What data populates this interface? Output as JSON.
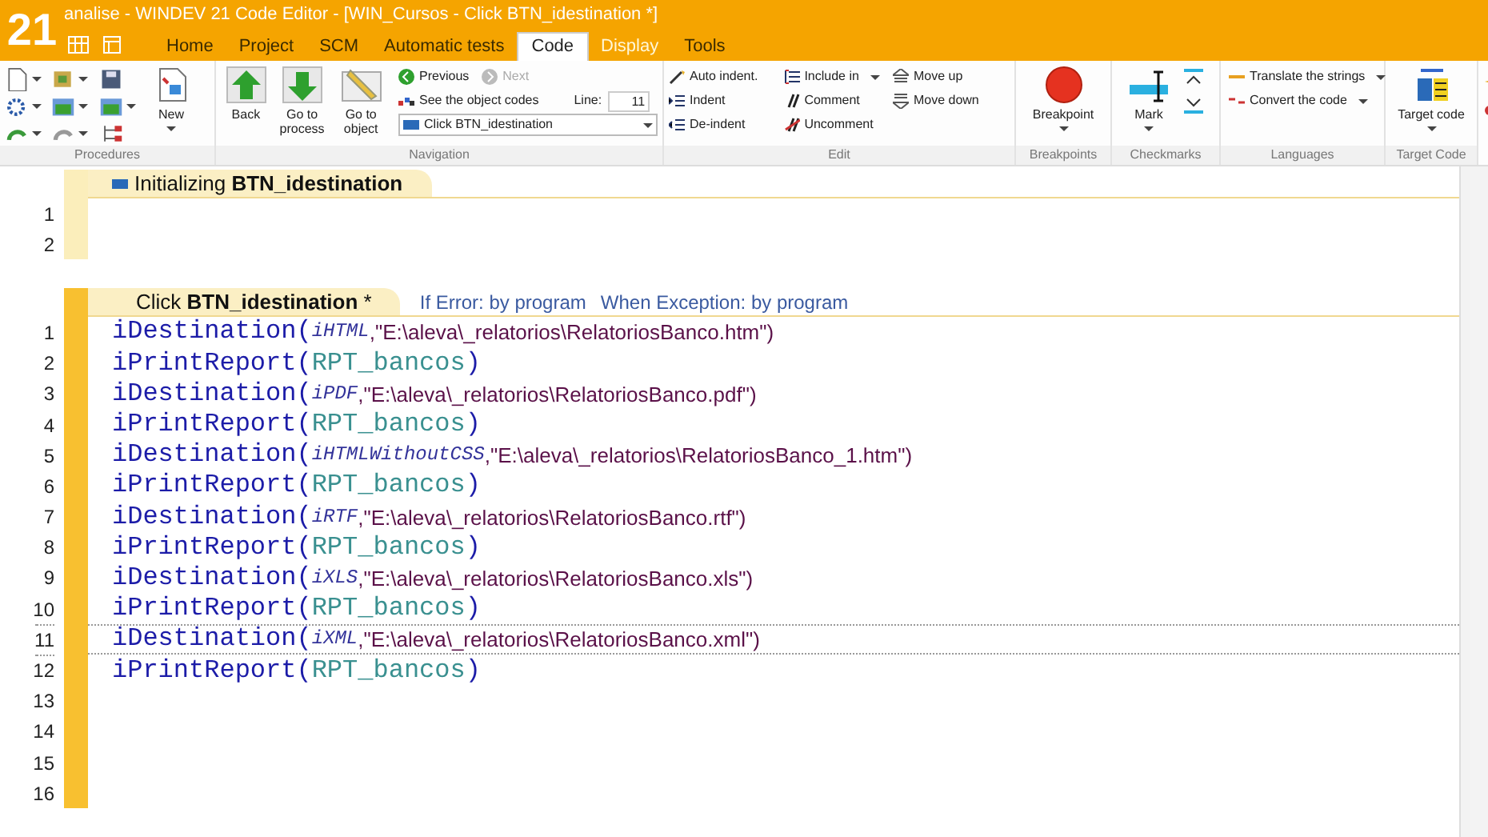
{
  "window": {
    "logo": "21",
    "title": "analise - WINDEV 21  Code Editor - [WIN_Cursos - Click BTN_idestination *]"
  },
  "tabs": [
    {
      "label": "Home",
      "selected": false
    },
    {
      "label": "Project",
      "selected": false
    },
    {
      "label": "SCM",
      "selected": false
    },
    {
      "label": "Automatic tests",
      "selected": false
    },
    {
      "label": "Code",
      "selected": true
    },
    {
      "label": "Display",
      "selected": false
    },
    {
      "label": "Tools",
      "selected": false
    }
  ],
  "ribbon": {
    "procedures": {
      "label": "Procedures",
      "new_button": "New"
    },
    "navigation": {
      "label": "Navigation",
      "back": "Back",
      "go_to_process": "Go to process",
      "go_to_object": "Go to object",
      "previous": {
        "label": "Previous",
        "disabled": false
      },
      "next": {
        "label": "Next",
        "disabled": true
      },
      "see_object_codes": "See the object codes",
      "line_label": "Line:",
      "line_value": "11",
      "current_process": "Click BTN_idestination"
    },
    "edit": {
      "label": "Edit",
      "items": [
        {
          "label": "Auto indent.",
          "dropdown": false
        },
        {
          "label": "Indent",
          "dropdown": false
        },
        {
          "label": "De-indent",
          "dropdown": false
        },
        {
          "label": "Include in",
          "dropdown": true
        },
        {
          "label": "Comment",
          "dropdown": false
        },
        {
          "label": "Uncomment",
          "dropdown": false
        },
        {
          "label": "Move up",
          "dropdown": false
        },
        {
          "label": "Move down",
          "dropdown": false
        }
      ]
    },
    "breakpoints": {
      "label": "Breakpoints",
      "button": "Breakpoint"
    },
    "checkmarks": {
      "label": "Checkmarks",
      "button": "Mark"
    },
    "languages": {
      "label": "Languages",
      "items": [
        "Translate the strings",
        "Convert the code"
      ]
    },
    "target_code": {
      "label": "Target Code",
      "button": "Target code"
    }
  },
  "editor": {
    "sections": [
      {
        "title": "Initializing **BTN_idestination**",
        "modified": false,
        "lines": [
          {
            "number": "1",
            "current": false
          },
          {
            "number": "2",
            "current": false
          }
        ]
      },
      {
        "title": "Click **BTN_idestination** *",
        "modified": true,
        "if_error": "If Error: by program",
        "when_exception": "When Exception: by program",
        "lines": [
          {
            "number": "1",
            "current": false,
            "tokens": [
              {
                "kind": "func",
                "text": "iDestination("
              },
              {
                "kind": "const",
                "text": "iHTML"
              },
              {
                "kind": "string",
                "text": ",\"E:\\aleva\\_relatorios\\RelatoriosBanco.htm\")"
              }
            ]
          },
          {
            "number": "2",
            "current": false,
            "tokens": [
              {
                "kind": "func",
                "text": "iPrintReport("
              },
              {
                "kind": "ident",
                "text": "RPT_bancos"
              },
              {
                "kind": "func",
                "text": ")"
              }
            ]
          },
          {
            "number": "3",
            "current": false,
            "tokens": [
              {
                "kind": "func",
                "text": "iDestination("
              },
              {
                "kind": "const",
                "text": "iPDF"
              },
              {
                "kind": "string",
                "text": ",\"E:\\aleva\\_relatorios\\RelatoriosBanco.pdf\")"
              }
            ]
          },
          {
            "number": "4",
            "current": false,
            "tokens": [
              {
                "kind": "func",
                "text": "iPrintReport("
              },
              {
                "kind": "ident",
                "text": "RPT_bancos"
              },
              {
                "kind": "func",
                "text": ")"
              }
            ]
          },
          {
            "number": "5",
            "current": false,
            "tokens": [
              {
                "kind": "func",
                "text": "iDestination("
              },
              {
                "kind": "const",
                "text": "iHTMLWithoutCSS"
              },
              {
                "kind": "string",
                "text": ",\"E:\\aleva\\_relatorios\\RelatoriosBanco_1.htm\")"
              }
            ]
          },
          {
            "number": "6",
            "current": false,
            "tokens": [
              {
                "kind": "func",
                "text": "iPrintReport("
              },
              {
                "kind": "ident",
                "text": "RPT_bancos"
              },
              {
                "kind": "func",
                "text": ")"
              }
            ]
          },
          {
            "number": "7",
            "current": false,
            "tokens": [
              {
                "kind": "func",
                "text": "iDestination("
              },
              {
                "kind": "const",
                "text": "iRTF"
              },
              {
                "kind": "string",
                "text": ",\"E:\\aleva\\_relatorios\\RelatoriosBanco.rtf\")"
              }
            ]
          },
          {
            "number": "8",
            "current": false,
            "tokens": [
              {
                "kind": "func",
                "text": "iPrintReport("
              },
              {
                "kind": "ident",
                "text": "RPT_bancos"
              },
              {
                "kind": "func",
                "text": ")"
              }
            ]
          },
          {
            "number": "9",
            "current": false,
            "tokens": [
              {
                "kind": "func",
                "text": "iDestination("
              },
              {
                "kind": "const",
                "text": "iXLS"
              },
              {
                "kind": "string",
                "text": ",\"E:\\aleva\\_relatorios\\RelatoriosBanco.xls\")"
              }
            ]
          },
          {
            "number": "10",
            "current": false,
            "tokens": [
              {
                "kind": "func",
                "text": "iPrintReport("
              },
              {
                "kind": "ident",
                "text": "RPT_bancos"
              },
              {
                "kind": "func",
                "text": ")"
              }
            ]
          },
          {
            "number": "11",
            "current": true,
            "tokens": [
              {
                "kind": "func",
                "text": "iDestination("
              },
              {
                "kind": "const",
                "text": "iXML"
              },
              {
                "kind": "string",
                "text": ",\"E:\\aleva\\_relatorios\\RelatoriosBanco.xml\")"
              }
            ]
          },
          {
            "number": "12",
            "current": false,
            "tokens": [
              {
                "kind": "func",
                "text": "iPrintReport("
              },
              {
                "kind": "ident",
                "text": "RPT_bancos"
              },
              {
                "kind": "func",
                "text": ")"
              }
            ]
          },
          {
            "number": "13",
            "current": false
          },
          {
            "number": "14",
            "current": false
          },
          {
            "number": "15",
            "current": false
          },
          {
            "number": "16",
            "current": false
          }
        ]
      }
    ]
  }
}
